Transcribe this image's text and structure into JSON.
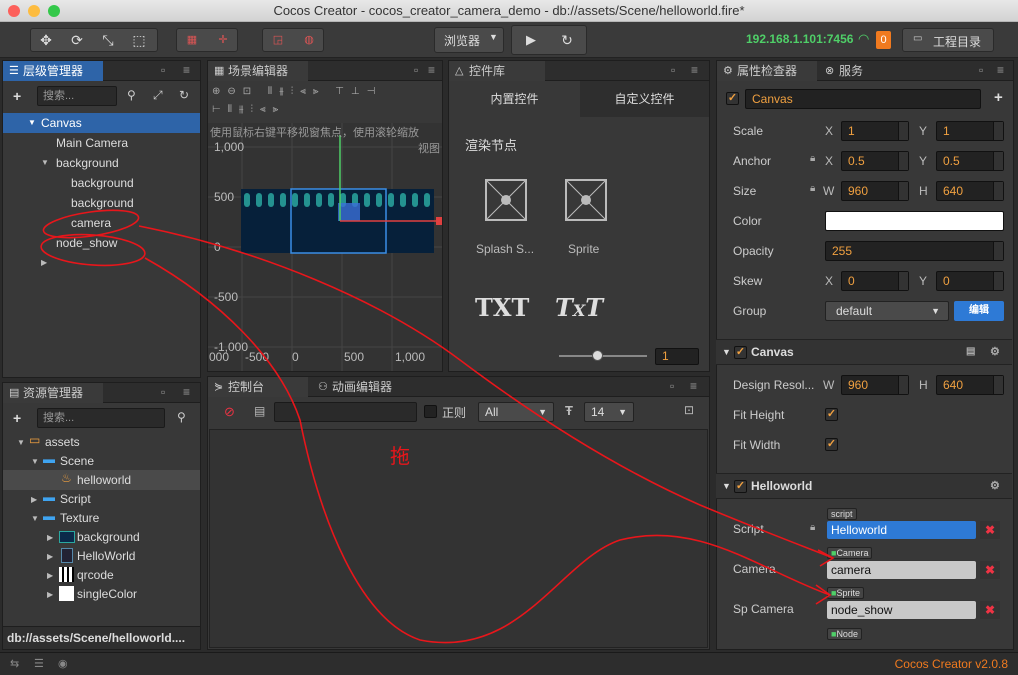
{
  "window": {
    "title": "Cocos Creator - cocos_creator_camera_demo - db://assets/Scene/helloworld.fire*"
  },
  "toolbar": {
    "browser_label": "浏览器",
    "ip": "192.168.1.101:7456",
    "badge": "0",
    "project_button": "工程目录"
  },
  "hierarchy": {
    "tab": "层级管理器",
    "search_placeholder": "搜索...",
    "items": [
      "Canvas",
      "Main Camera",
      "background",
      "background",
      "background",
      "camera",
      "node_show"
    ]
  },
  "scene": {
    "tab": "场景编辑器",
    "hint": "使用鼠标右键平移视窗焦点，使用滚轮缩放",
    "hint2": "视图",
    "y_ticks": [
      "1,000",
      "500",
      "0",
      "-500",
      "-1,000"
    ],
    "x_ticks": [
      "000",
      "-500",
      "0",
      "500",
      "1,000"
    ]
  },
  "widgets": {
    "tab": "控件库",
    "builtin_tab": "内置控件",
    "custom_tab": "自定义控件",
    "section": "渲染节点",
    "items": [
      "Splash S...",
      "Sprite"
    ],
    "zoom_value": "1"
  },
  "inspector": {
    "tab": "属性检查器",
    "tab2": "服务",
    "node_name": "Canvas",
    "scale": {
      "label": "Scale",
      "x": "1",
      "y": "1"
    },
    "anchor": {
      "label": "Anchor",
      "x": "0.5",
      "y": "0.5"
    },
    "size": {
      "label": "Size",
      "w": "960",
      "h": "640"
    },
    "color": {
      "label": "Color"
    },
    "opacity": {
      "label": "Opacity",
      "value": "255"
    },
    "skew": {
      "label": "Skew",
      "x": "0",
      "y": "0"
    },
    "group": {
      "label": "Group",
      "value": "default",
      "edit": "编辑"
    },
    "canvas_section": "Canvas",
    "design_res": {
      "label": "Design Resol...",
      "w": "960",
      "h": "640"
    },
    "fit_height": "Fit Height",
    "fit_width": "Fit Width",
    "helloworld_section": "Helloworld",
    "script": {
      "label": "Script",
      "tag": "script",
      "value": "Helloworld"
    },
    "camera": {
      "label": "Camera",
      "tag": "Camera",
      "value": "camera"
    },
    "sp_camera": {
      "label": "Sp Camera",
      "tag": "Sprite",
      "value": "node_show"
    },
    "node_tag": "Node",
    "axis_x": "X",
    "axis_y": "Y",
    "axis_w": "W",
    "axis_h": "H"
  },
  "assets": {
    "tab": "资源管理器",
    "search_placeholder": "搜索...",
    "items": [
      "assets",
      "Scene",
      "helloworld",
      "Script",
      "Texture",
      "background",
      "HelloWorld",
      "qrcode",
      "singleColor"
    ],
    "path": "db://assets/Scene/helloworld...."
  },
  "console": {
    "tab": "控制台",
    "anim_tab": "动画编辑器",
    "regex_label": "正则",
    "filter": "All",
    "font_size": "14"
  },
  "annotation": {
    "text": "拖"
  },
  "status": {
    "version": "Cocos Creator v2.0.8"
  }
}
